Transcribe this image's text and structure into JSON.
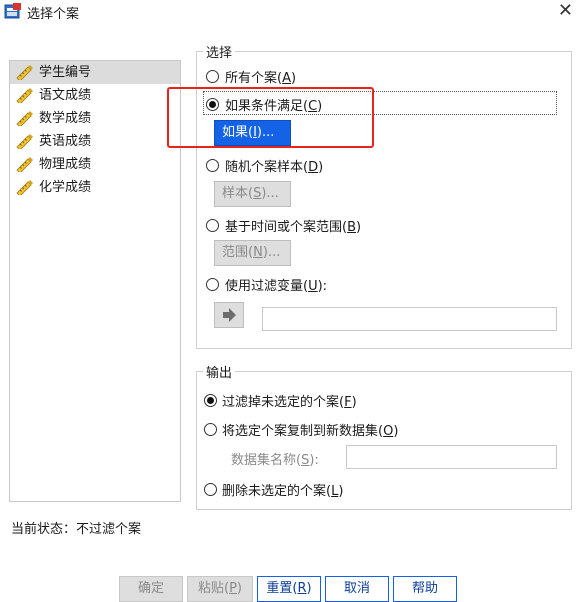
{
  "window": {
    "title": "选择个案"
  },
  "variables": [
    "学生编号",
    "语文成绩",
    "数学成绩",
    "英语成绩",
    "物理成绩",
    "化学成绩"
  ],
  "selection": {
    "legend": "选择",
    "options": {
      "all": {
        "text": "所有个案(",
        "key": "A",
        "close": ")"
      },
      "if": {
        "text": "如果条件满足(",
        "key": "C",
        "close": ")"
      },
      "random": {
        "text": "随机个案样本(",
        "key": "D",
        "close": ")"
      },
      "range": {
        "text": "基于时间或个案范围(",
        "key": "B",
        "close": ")"
      },
      "filter": {
        "text": "使用过滤变量(",
        "key": "U",
        "close": "):"
      }
    },
    "if_button": {
      "text": "如果(",
      "key": "I",
      "close": ")..."
    },
    "sample_button": {
      "text": "样本(",
      "key": "S",
      "close": ")..."
    },
    "range_button": {
      "text": "范围(",
      "key": "N",
      "close": ")..."
    }
  },
  "output": {
    "legend": "输出",
    "options": {
      "filter": {
        "text": "过滤掉未选定的个案(",
        "key": "F",
        "close": ")"
      },
      "copy": {
        "text": "将选定个案复制到新数据集(",
        "key": "O",
        "close": ")"
      },
      "delete": {
        "text": "删除未选定的个案(",
        "key": "L",
        "close": ")"
      }
    },
    "dataset_label": {
      "text": "数据集名称(",
      "key": "S",
      "close": "):"
    }
  },
  "status": "当前状态：不过滤个案",
  "buttons": {
    "ok": "确定",
    "paste": {
      "text": "粘贴(",
      "key": "P",
      "close": ")"
    },
    "reset": {
      "text": "重置(",
      "key": "R",
      "close": ")"
    },
    "cancel": "取消",
    "help": "帮助"
  },
  "icons": {
    "app": "spss-dialog-icon",
    "variable": "ruler-pencil-icon",
    "arrow": "arrow-right-icon",
    "close": "close-icon"
  },
  "colors": {
    "accent": "#1463e6",
    "highlight": "#e8221d"
  }
}
